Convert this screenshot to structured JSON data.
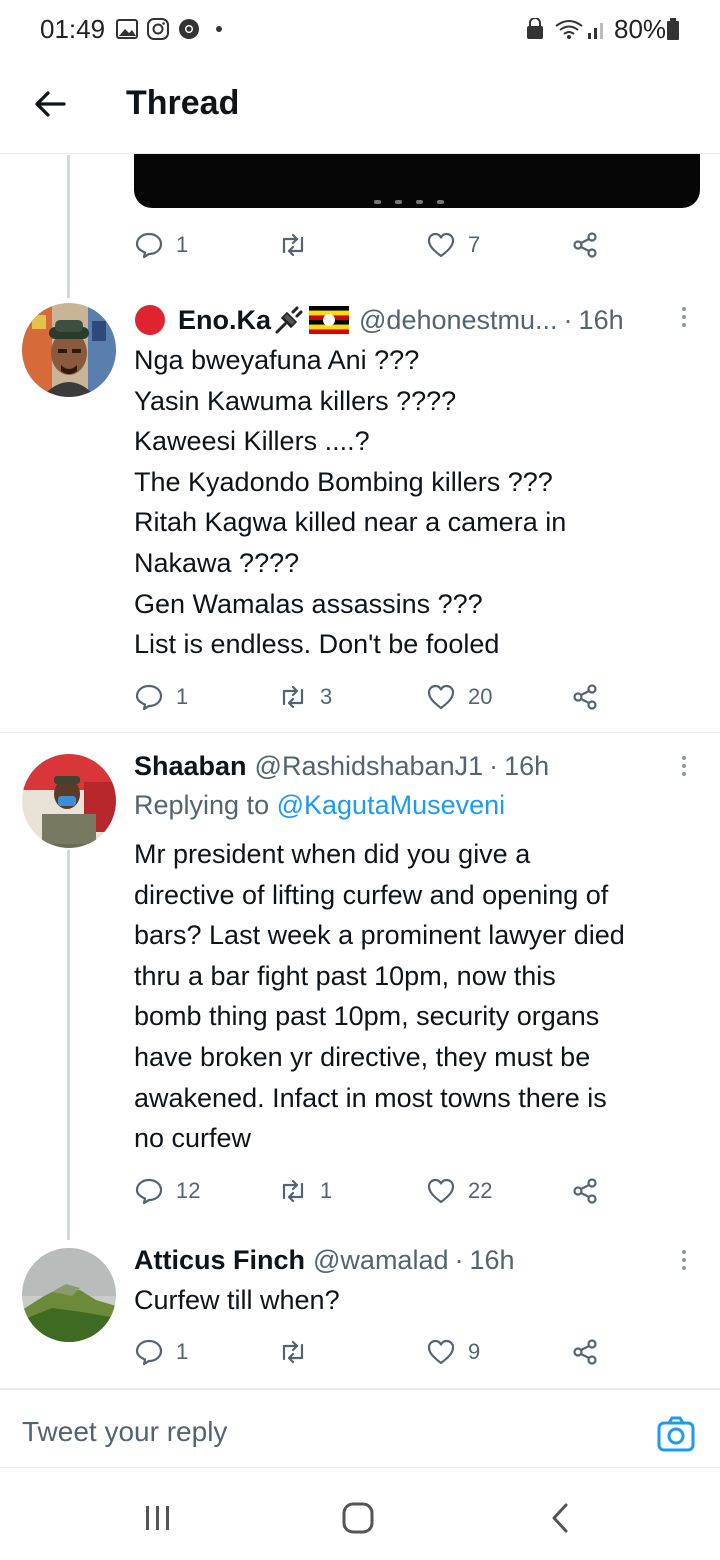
{
  "status_bar": {
    "time": "01:49",
    "battery": "80%",
    "icons": [
      "gallery-icon",
      "instagram-icon",
      "chrome-icon",
      "dot-icon",
      "lock-icon",
      "wifi-icon",
      "signal-icon",
      "battery-icon"
    ]
  },
  "header": {
    "title": "Thread",
    "back_icon": "arrow-left-icon"
  },
  "colors": {
    "text": "#0f1419",
    "muted": "#536471",
    "link": "#1d9bf0",
    "divider": "#e6ecf0",
    "thread_line": "#cfd9de"
  },
  "prev_tweet_actions": {
    "replies": "1",
    "retweets": "",
    "likes": "7"
  },
  "tweets": [
    {
      "name": "Eno.Ka",
      "handle": "@dehonestmu...",
      "time": "16h",
      "body_lines": [
        "Nga bweyafuna Ani ???",
        "Yasin Kawuma killers ????",
        "Kaweesi Killers ....?",
        "The Kyadondo Bombing killers ???",
        "Ritah Kagwa killed near a camera in",
        "Nakawa ????",
        "Gen Wamalas assassins ???",
        "List is endless. Don't be fooled"
      ],
      "replies": "1",
      "retweets": "3",
      "likes": "20"
    },
    {
      "name": "Shaaban",
      "handle": "@RashidshabanJ1",
      "time": "16h",
      "replying_prefix": "Replying to",
      "replying_to": "@KagutaMuseveni",
      "body_lines": [
        "Mr president when did you give a",
        "directive of lifting curfew and opening of",
        "bars? Last week a prominent lawyer died",
        "thru a bar fight past 10pm, now this",
        "bomb thing past 10pm, security organs",
        "have broken yr directive, they must be",
        "awakened. Infact in most towns there is",
        "no curfew"
      ],
      "replies": "12",
      "retweets": "1",
      "likes": "22"
    },
    {
      "name": "Atticus Finch",
      "handle": "@wamalad",
      "time": "16h",
      "body_lines": [
        "Curfew till when?"
      ],
      "replies": "1",
      "retweets": "",
      "likes": "9"
    }
  ],
  "reply_box": {
    "placeholder": "Tweet your reply",
    "camera_icon": "camera-icon"
  },
  "nav": [
    "recent-apps-icon",
    "home-icon",
    "back-icon"
  ]
}
